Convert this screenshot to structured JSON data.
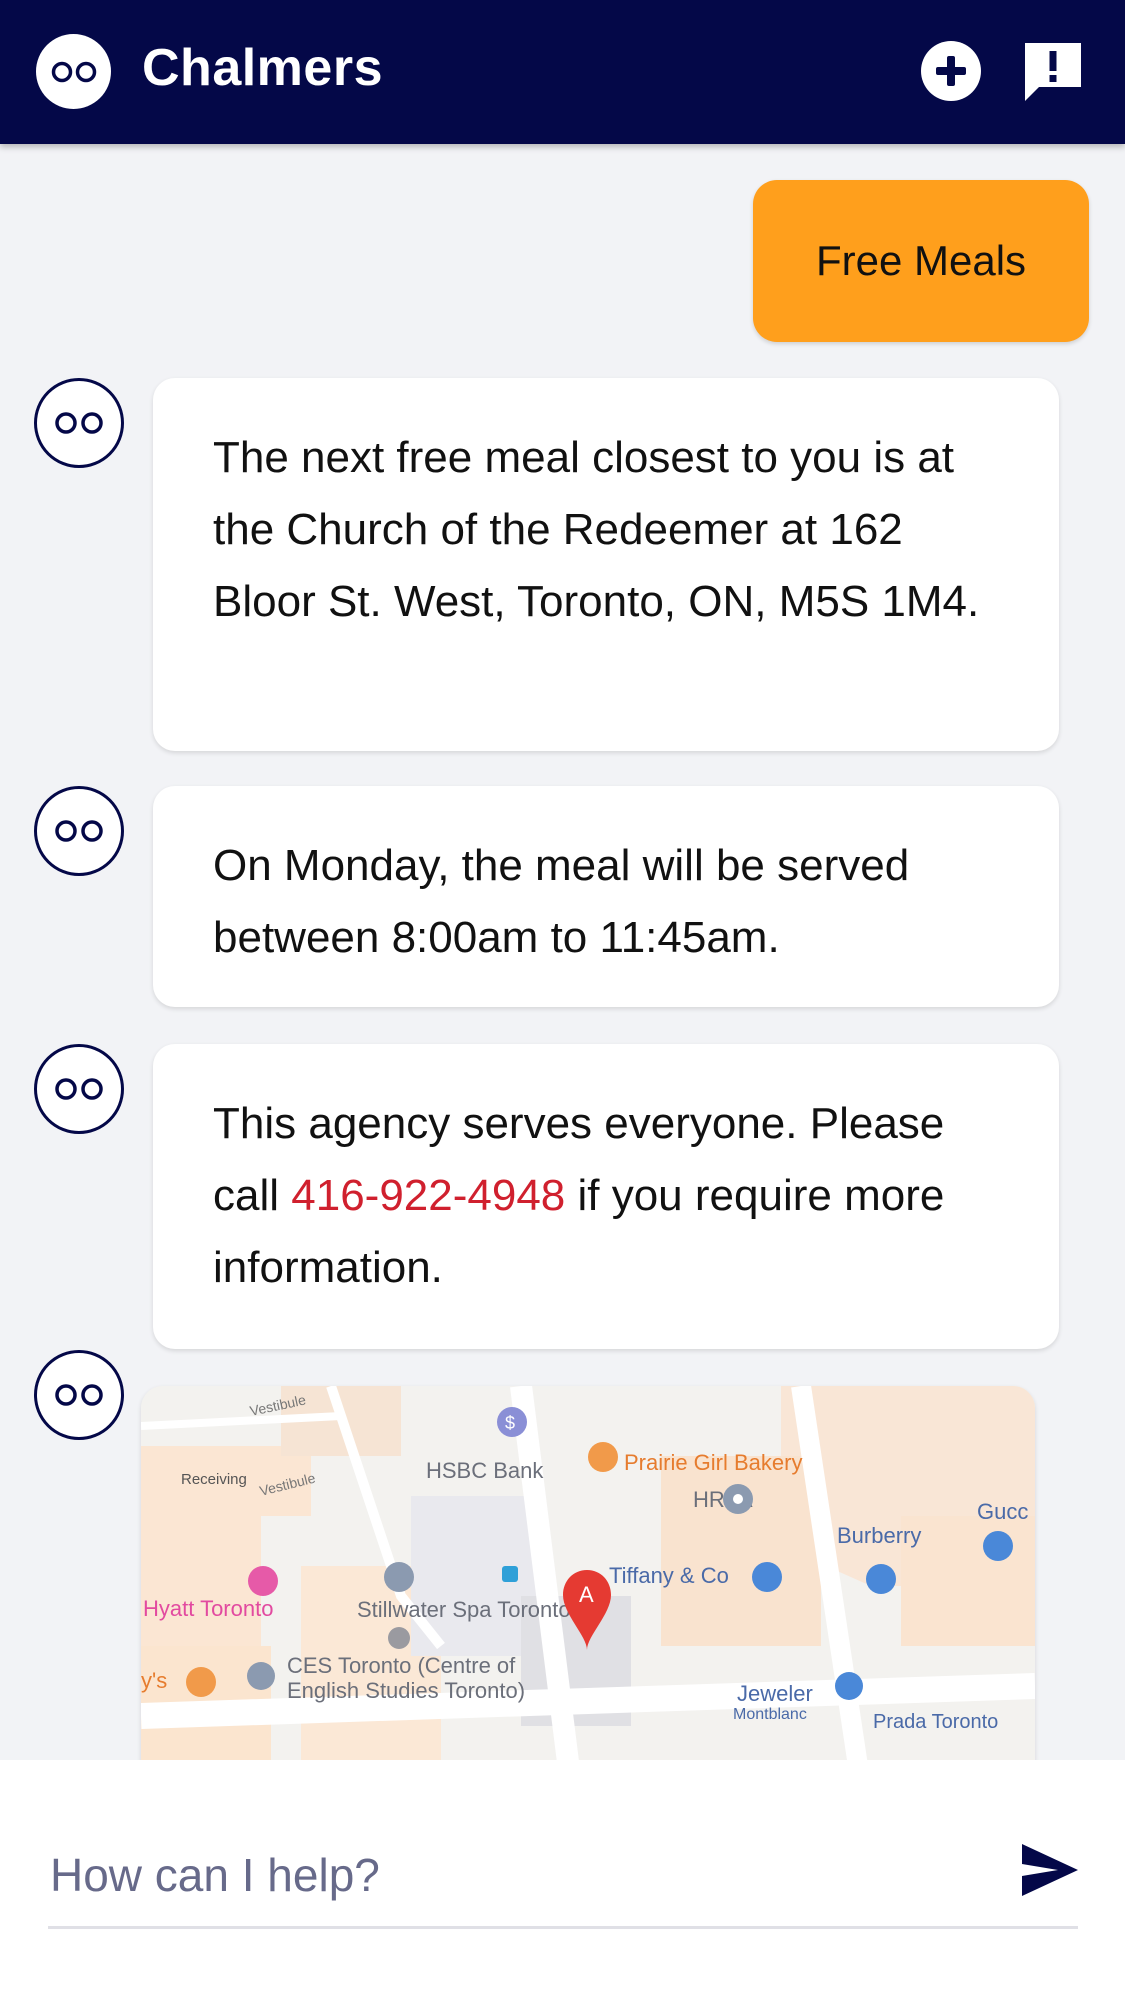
{
  "header": {
    "title": "Chalmers",
    "add_icon": "plus-circle-icon",
    "feedback_icon": "feedback-alert-icon"
  },
  "colors": {
    "header_bg": "#040848",
    "user_bubble": "#ff9f1c",
    "phone_link": "#d0202e",
    "background": "#f2f3f6"
  },
  "conversation": {
    "user_message": "Free Meals",
    "bot_messages": [
      {
        "text": "The next free meal closest to you is at the Church of the Redeemer at 162 Bloor St. West, Toronto, ON, M5S 1M4."
      },
      {
        "text": "On Monday, the meal will be served between 8:00am to 11:45am."
      },
      {
        "text_before": "This agency serves everyone. Please call ",
        "phone": "416-922-4948",
        "text_after": " if you require more information."
      }
    ]
  },
  "map": {
    "labels": {
      "vestibule_1": "Vestibule",
      "vestibule_2": "Vestibule",
      "receiving": "Receiving",
      "hsbc": "HSBC Bank",
      "prairie": "Prairie Girl Bakery",
      "hrpa": "HRPA",
      "burberry": "Burberry",
      "gucci": "Gucc",
      "tiffany": "Tiffany & Co",
      "hyatt": "Hyatt Toronto",
      "stillwater": "Stillwater Spa Toronto",
      "ces_1": "CES Toronto (Centre of",
      "ces_2": "English Studies Toronto)",
      "joeys": "y's",
      "jeweler": "Jeweler",
      "montblanc": "Montblanc",
      "prada": "Prada Toronto",
      "marker": "A"
    }
  },
  "input": {
    "placeholder": "How can I help?",
    "send_icon": "send-icon"
  }
}
